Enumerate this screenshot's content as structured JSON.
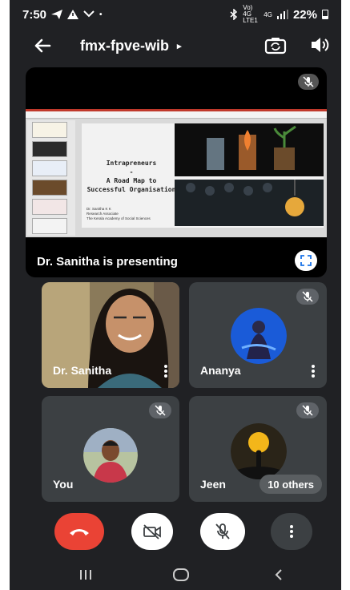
{
  "status_bar": {
    "time": "7:50",
    "network_label": "Vo) 4G LTE1",
    "signal_label": "4G",
    "battery": "22%"
  },
  "top_bar": {
    "meeting_code": "fmx-fpve-wib",
    "caret": "▸"
  },
  "presentation": {
    "slide": {
      "title_line1": "Intrapreneurs",
      "title_dash": "-",
      "title_line2": "A Road Map to",
      "title_line3": "Successful Organisation",
      "author_line1": "Dr. Sanitha K K",
      "author_line2": "Research Associate",
      "author_line3": "The Kerala Academy of Social Sciences"
    },
    "presenting_label": "Dr. Sanitha is presenting"
  },
  "participants": [
    {
      "name": "Dr. Sanitha"
    },
    {
      "name": "Ananya"
    },
    {
      "name": "You"
    },
    {
      "name": "Jeen"
    }
  ],
  "others_label": "10 others",
  "colors": {
    "background": "#202124",
    "tile": "#3c4043",
    "end_call": "#ea4335"
  }
}
